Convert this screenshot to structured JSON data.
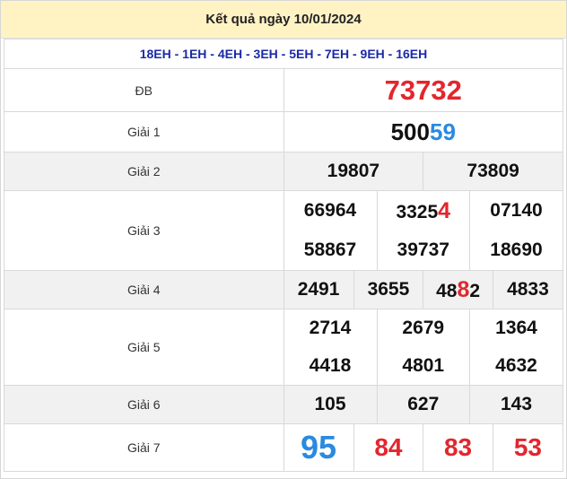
{
  "title": "Kết quả ngày 10/01/2024",
  "codes": "18EH - 1EH - 4EH - 3EH - 5EH - 7EH - 9EH - 16EH",
  "labels": {
    "db": "ĐB",
    "g1": "Giải 1",
    "g2": "Giải 2",
    "g3": "Giải 3",
    "g4": "Giải 4",
    "g5": "Giải 5",
    "g6": "Giải 6",
    "g7": "Giải 7"
  },
  "db": "73732",
  "g1": {
    "prefix": "500",
    "tail": "59"
  },
  "g2": [
    "19807",
    "73809"
  ],
  "g3": {
    "a1": "66964",
    "a2_prefix": "3325",
    "a2_tail": "4",
    "a3": "07140",
    "b1": "58867",
    "b2": "39737",
    "b3": "18690"
  },
  "g4": {
    "n1": "2491",
    "n2": "3655",
    "n3_a": "48",
    "n3_b": "8",
    "n3_c": "2",
    "n4": "4833"
  },
  "g5": [
    "2714",
    "2679",
    "1364",
    "4418",
    "4801",
    "4632"
  ],
  "g6": [
    "105",
    "627",
    "143"
  ],
  "g7": [
    "95",
    "84",
    "83",
    "53"
  ],
  "colors": {
    "highlight_red": "#e3262e",
    "highlight_blue": "#2a8ae0",
    "header_bg": "#fff3c4",
    "codes_text": "#1a2aa8"
  }
}
